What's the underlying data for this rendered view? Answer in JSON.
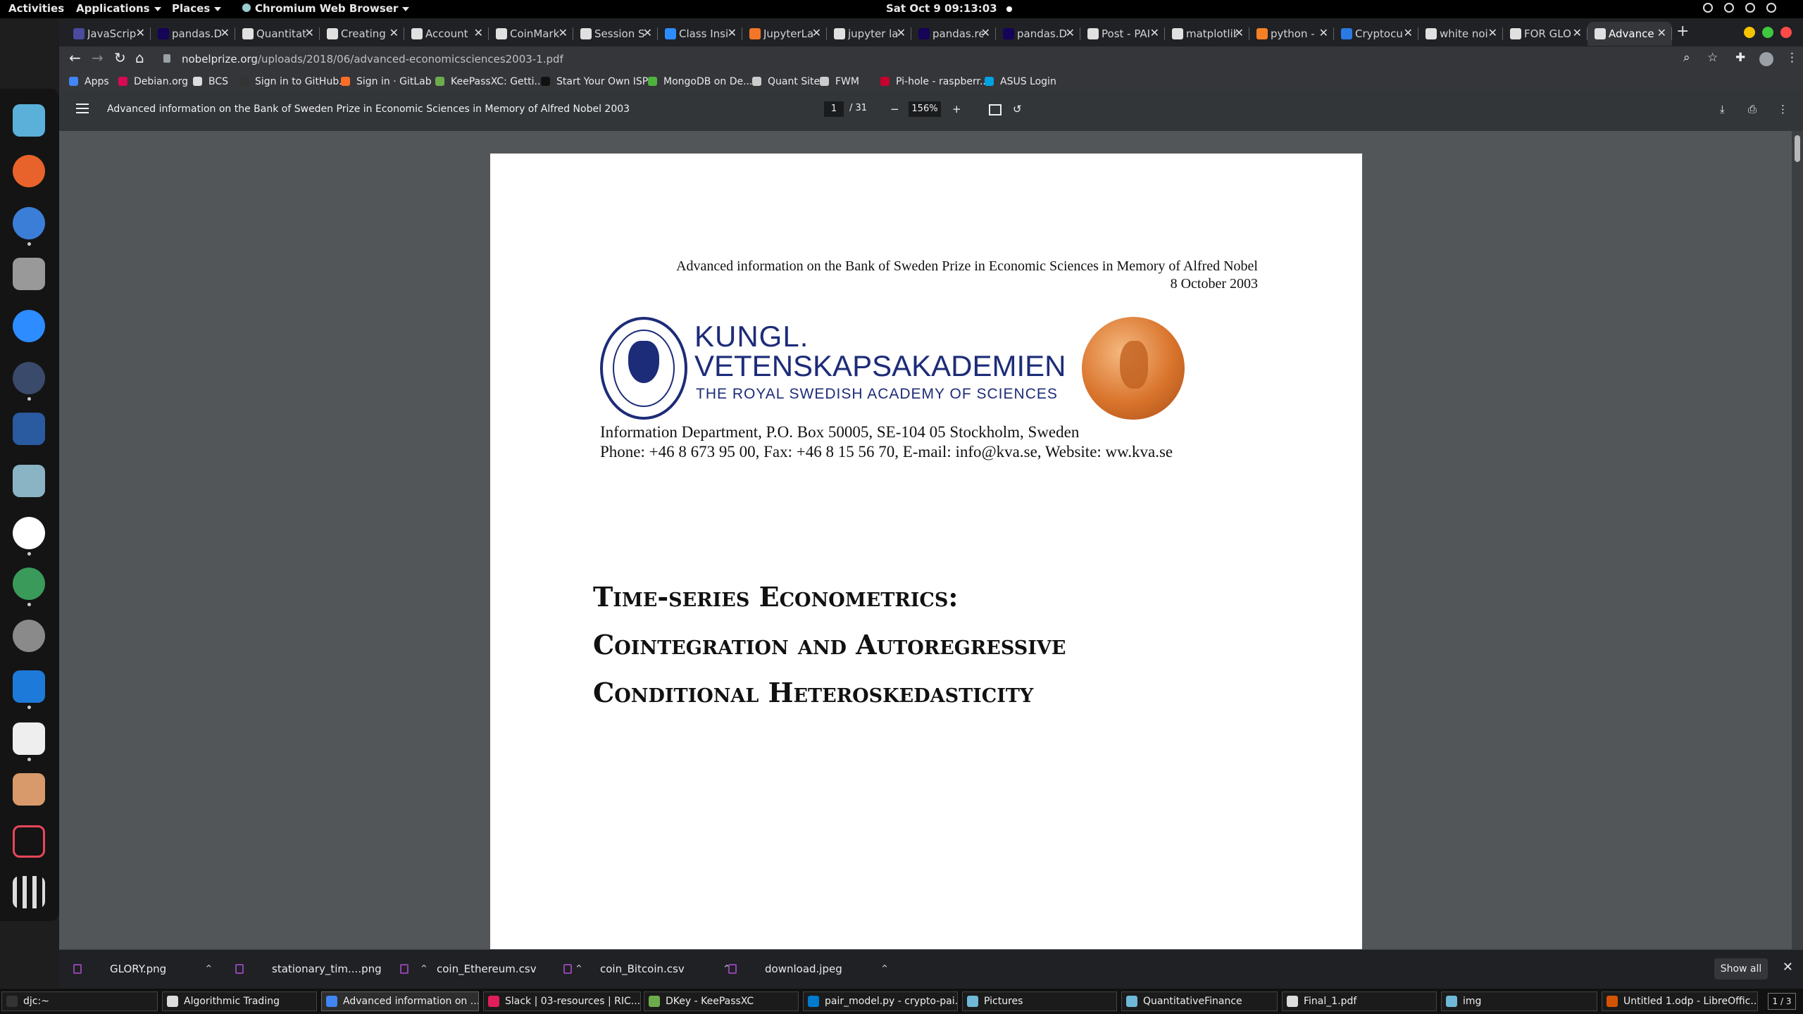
{
  "topbar": {
    "activities": "Activities",
    "applications": "Applications",
    "places": "Places",
    "app_name": "Chromium Web Browser",
    "clock": "Sat Oct 9  09:13:03"
  },
  "tabs": [
    {
      "title": "JavaScrip",
      "color": "#4a4a9e"
    },
    {
      "title": "pandas.D",
      "color": "#150458"
    },
    {
      "title": "Quantitat",
      "color": "#e0e0e0"
    },
    {
      "title": "Creating",
      "color": "#e0e0e0"
    },
    {
      "title": "Account",
      "color": "#e0e0e0"
    },
    {
      "title": "CoinMark",
      "color": "#e0e0e0"
    },
    {
      "title": "Session S",
      "color": "#e0e0e0"
    },
    {
      "title": "Class Insi",
      "color": "#2d8cff"
    },
    {
      "title": "JupyterLa",
      "color": "#f37626"
    },
    {
      "title": "jupyter la",
      "color": "#e0e0e0"
    },
    {
      "title": "pandas.re",
      "color": "#150458"
    },
    {
      "title": "pandas.D",
      "color": "#150458"
    },
    {
      "title": "Post - PAI",
      "color": "#e0e0e0"
    },
    {
      "title": "matplotlib",
      "color": "#e0e0e0"
    },
    {
      "title": "python -",
      "color": "#f48024"
    },
    {
      "title": "Cryptocu",
      "color": "#2a7ae2"
    },
    {
      "title": "white noi",
      "color": "#e0e0e0"
    },
    {
      "title": "FOR GLO",
      "color": "#e0e0e0"
    },
    {
      "title": "Advance",
      "color": "#e0e0e0"
    }
  ],
  "address": {
    "host": "nobelprize.org",
    "path": "/uploads/2018/06/advanced-economicsciences2003-1.pdf"
  },
  "bookmarks": [
    {
      "label": "Apps",
      "color": "#4285f4"
    },
    {
      "label": "Debian.org",
      "color": "#d70a53"
    },
    {
      "label": "BCS",
      "color": "#dddddd"
    },
    {
      "label": "Sign in to GitHub...",
      "color": "#333333"
    },
    {
      "label": "Sign in · GitLab",
      "color": "#fc6d26"
    },
    {
      "label": "KeePassXC: Getti...",
      "color": "#6cac4d"
    },
    {
      "label": "Start Your Own ISP",
      "color": "#111111"
    },
    {
      "label": "MongoDB on De...",
      "color": "#4db33d"
    },
    {
      "label": "Quant Sites",
      "color": "#cccccc"
    },
    {
      "label": "FWM",
      "color": "#cccccc"
    },
    {
      "label": "Pi-hole - raspberr...",
      "color": "#c7002d"
    },
    {
      "label": "ASUS Login",
      "color": "#00a3e0"
    }
  ],
  "pdf": {
    "doc_title": "Advanced information on the Bank of Sweden Prize in Economic Sciences in Memory of Alfred Nobel 2003",
    "page_current": "1",
    "page_total": "/ 31",
    "zoom": "156%"
  },
  "page": {
    "header_line1": "Advanced information on the Bank of Sweden Prize in Economic Sciences in Memory of Alfred Nobel",
    "header_line2": "8 October 2003",
    "kva_line1": "KUNGL.",
    "kva_line2": "VETENSKAPSAKADEMIEN",
    "kva_line3": "THE ROYAL SWEDISH ACADEMY OF SCIENCES",
    "address_line": "Information Department, P.O. Box 50005, SE-104 05 Stockholm, Sweden",
    "contact_line": "Phone: +46 8 673 95 00, Fax: +46 8 15 56 70, E-mail: info@kva.se, Website: ww.kva.se",
    "title_line1": "Time-series Econometrics:",
    "title_line2": "Cointegration and Autoregressive",
    "title_line3": "Conditional Heteroskedasticity"
  },
  "downloads": {
    "items": [
      "GLORY.png",
      "stationary_tim....png",
      "coin_Ethereum.csv",
      "coin_Bitcoin.csv",
      "download.jpeg"
    ],
    "show_all": "Show all"
  },
  "taskbar": {
    "items": [
      {
        "label": "djc:~",
        "color": "#333"
      },
      {
        "label": "Algorithmic Trading",
        "color": "#ddd"
      },
      {
        "label": "Advanced information on ...",
        "color": "#4285f4"
      },
      {
        "label": "Slack | 03-resources | RIC...",
        "color": "#e01e5a"
      },
      {
        "label": "DKey - KeePassXC",
        "color": "#6cac4d"
      },
      {
        "label": "pair_model.py - crypto-pai...",
        "color": "#007acc"
      },
      {
        "label": "Pictures",
        "color": "#6fb8d8"
      },
      {
        "label": "QuantitativeFinance",
        "color": "#6fb8d8"
      },
      {
        "label": "Final_1.pdf",
        "color": "#ddd"
      },
      {
        "label": "img",
        "color": "#6fb8d8"
      },
      {
        "label": "Untitled 1.odp - LibreOffic...",
        "color": "#d35400"
      }
    ],
    "pager": "1 / 3"
  }
}
